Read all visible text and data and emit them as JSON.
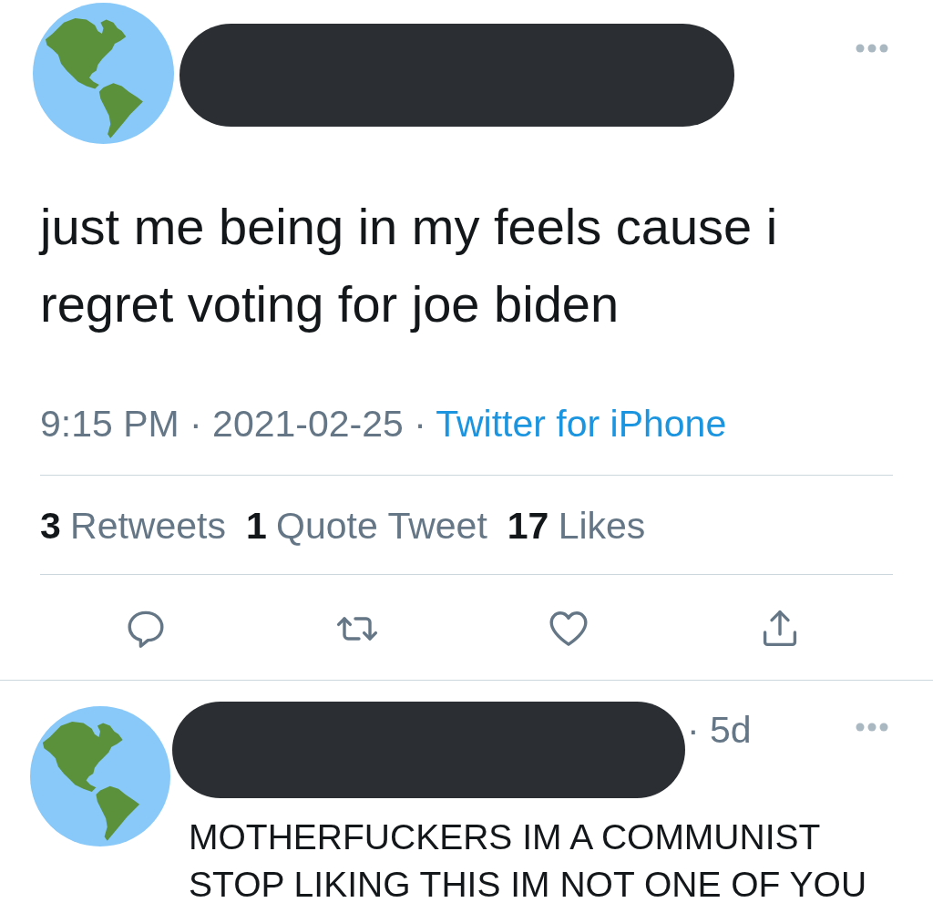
{
  "tweet": {
    "author": {
      "name_redacted": true
    },
    "text": "just me being in my feels cause i regret voting for joe biden",
    "timestamp": "9:15 PM · 2021-02-25 ·",
    "source": "Twitter for iPhone",
    "stats": [
      {
        "count": "3",
        "label": "Retweets"
      },
      {
        "count": "1",
        "label": "Quote Tweet"
      },
      {
        "count": "17",
        "label": "Likes"
      }
    ],
    "actions": [
      {
        "kind": "reply"
      },
      {
        "kind": "retweet"
      },
      {
        "kind": "like"
      },
      {
        "kind": "share"
      }
    ]
  },
  "reply": {
    "author": {
      "name_redacted": true
    },
    "time": "· 5d",
    "text": "MOTHERFUCKERS IM A COMMUNIST STOP LIKING THIS IM NOT ONE OF YOU"
  }
}
